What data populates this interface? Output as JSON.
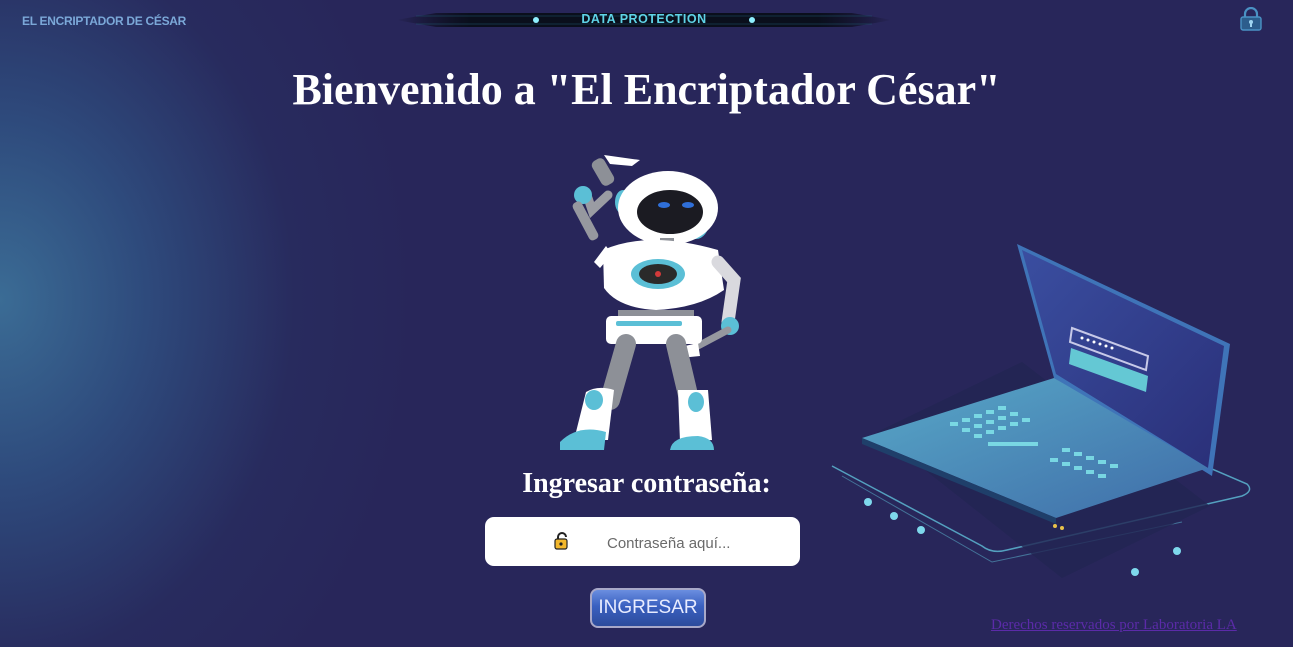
{
  "header": {
    "brand": "EL ENCRIPTADOR DE CÉSAR",
    "banner_text": "DATA PROTECTION",
    "corner_icon": "padlock-icon"
  },
  "main": {
    "title": "Bienvenido a \"El Encriptador César\"",
    "illustration": "robot-illustration",
    "password_label": "Ingresar contraseña:",
    "password_placeholder": "Contraseña aquí...",
    "password_value": "",
    "password_icon": "key-lock-icon",
    "submit_label": "INGRESAR",
    "side_illustration": "laptop-illustration"
  },
  "footer": {
    "text": "Derechos reservados por Laboratoria LA"
  },
  "colors": {
    "background": "#28265a",
    "accent_cyan": "#5fd3e6",
    "button": "#3a60c0",
    "footer_link": "#5b2ba8"
  }
}
